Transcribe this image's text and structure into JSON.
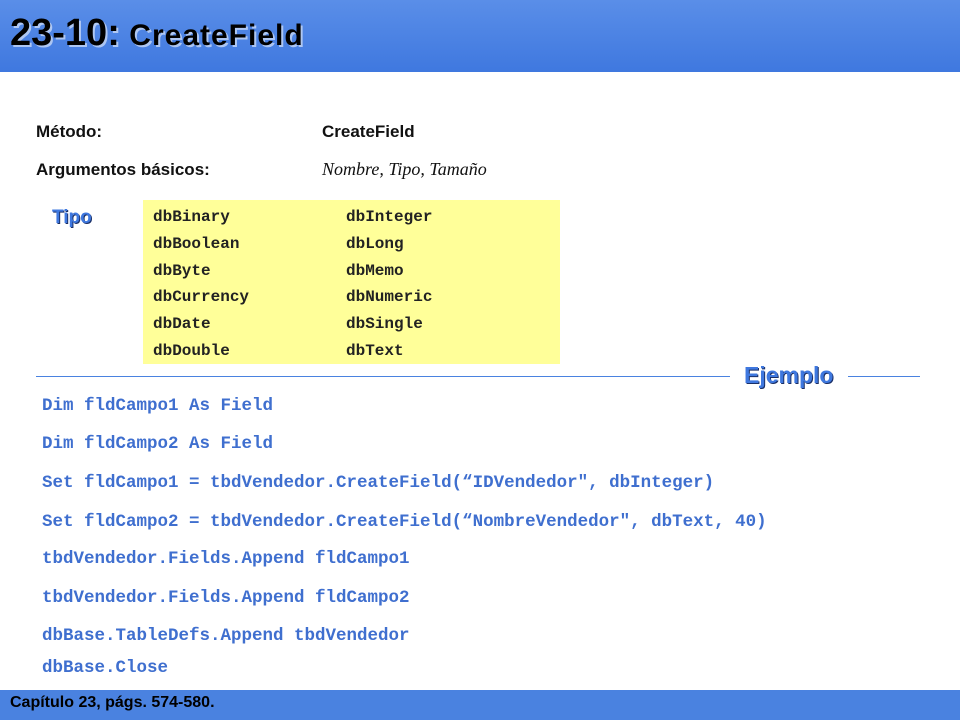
{
  "header": {
    "number": "23-10:",
    "name": "CreateField"
  },
  "method": {
    "label": "Método:",
    "value": "CreateField"
  },
  "arguments": {
    "label": "Argumentos básicos:",
    "value": "Nombre, Tipo, Tamaño"
  },
  "types": {
    "label": "Tipo",
    "column1": [
      "dbBinary",
      "dbBoolean",
      "dbByte",
      "dbCurrency",
      "dbDate",
      "dbDouble"
    ],
    "column2": [
      "dbInteger",
      "dbLong",
      "dbMemo",
      "dbNumeric",
      "dbSingle",
      "dbText"
    ]
  },
  "example": {
    "label": "Ejemplo",
    "lines": [
      "Dim fldCampo1 As Field",
      "Dim fldCampo2 As Field",
      "Set fldCampo1 = tbdVendedor.CreateField(“IDVendedor\", dbInteger)",
      "Set fldCampo2 = tbdVendedor.CreateField(“NombreVendedor\", dbText, 40)",
      "tbdVendedor.Fields.Append fldCampo1",
      "tbdVendedor.Fields.Append fldCampo2",
      "dbBase.TableDefs.Append tbdVendedor",
      "dbBase.Close"
    ]
  },
  "footer": {
    "text": "Capítulo 23, págs. 574-580."
  },
  "colors": {
    "accent": "#3f78df",
    "typebox": "#ffff99",
    "code": "#3f6fcf"
  }
}
